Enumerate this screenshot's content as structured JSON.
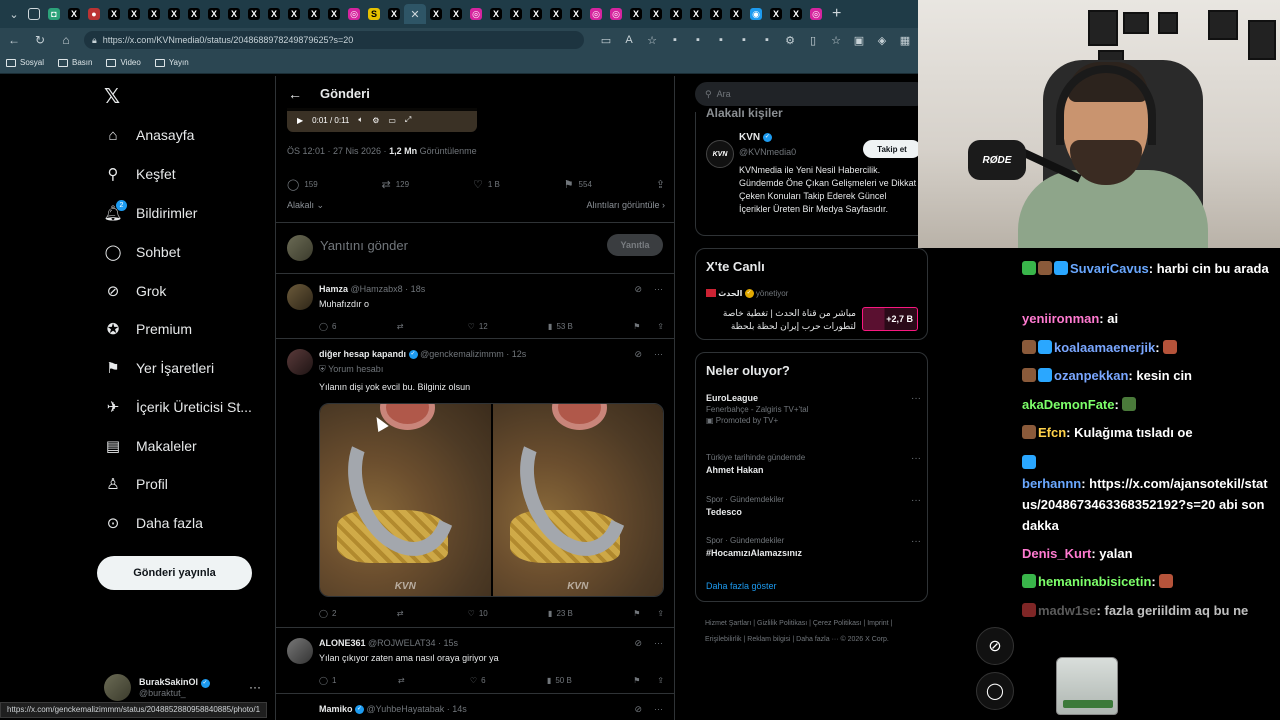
{
  "browser": {
    "url": "https://x.com/KVNmedia0/status/2048688978249879625?s=20",
    "bookmarks": [
      "Sosyal",
      "Basın",
      "Video",
      "Yayın"
    ],
    "status_link": "https://x.com/genckemalizimmm/status/2048852880958840885/photo/1"
  },
  "sidebar": {
    "logo": "𝕏",
    "items": [
      {
        "label": "Anasayfa",
        "icon": "home-icon"
      },
      {
        "label": "Keşfet",
        "icon": "search-icon"
      },
      {
        "label": "Bildirimler",
        "icon": "bell-icon",
        "badge": "2"
      },
      {
        "label": "Sohbet",
        "icon": "chat-icon"
      },
      {
        "label": "Grok",
        "icon": "grok-icon"
      },
      {
        "label": "Premium",
        "icon": "premium-icon"
      },
      {
        "label": "Yer İşaretleri",
        "icon": "bookmark-icon"
      },
      {
        "label": "İçerik Üreticisi St...",
        "icon": "rocket-icon"
      },
      {
        "label": "Makaleler",
        "icon": "article-icon"
      },
      {
        "label": "Profil",
        "icon": "person-icon"
      },
      {
        "label": "Daha fazla",
        "icon": "more-icon"
      }
    ],
    "post_button": "Gönderi yayınla",
    "profile": {
      "name": "BurakSakinOl",
      "handle": "@buraktut_",
      "more": "···"
    }
  },
  "main": {
    "header_title": "Gönderi",
    "video_time": "0:01 / 0:11",
    "meta_time": "ÖS 12:01 · 27 Nis 2026 · ",
    "meta_views": "1,2 Mn",
    "meta_views_label": " Görüntülenme",
    "stats": {
      "replies": "159",
      "reposts": "129",
      "likes": "1 B",
      "bookmarks": "554"
    },
    "sort_label": "Alakalı",
    "quotes_label": "Alıntıları görüntüle",
    "reply_placeholder": "Yanıtını gönder",
    "reply_button": "Yanıtla",
    "tweets": [
      {
        "name": "Hamza",
        "handle": "@Hamzabx8 · 18s",
        "text": "Muhafızdır o",
        "replies": "6",
        "reposts": "",
        "likes": "12",
        "views": "53 B"
      },
      {
        "name": "diğer hesap kapandı",
        "handle": "@genckemalizimmm · 12s",
        "note": "Yorum hesabı",
        "text": "Yılanın dişi yok evcil bu. Bilginiz olsun",
        "watermark": "KVN",
        "replies": "2",
        "reposts": "",
        "likes": "10",
        "views": "23 B"
      },
      {
        "name": "ALONE361",
        "handle": "@ROJWELAT34 · 15s",
        "text": "Yılan çıkıyor zaten ama nasıl oraya giriyor ya",
        "replies": "1",
        "reposts": "",
        "likes": "6",
        "views": "50 B"
      },
      {
        "name": "Mamiko",
        "handle": "@YuhbeHayatabak · 14s",
        "text": "",
        "replies": "",
        "reposts": "",
        "likes": "",
        "views": ""
      }
    ]
  },
  "right": {
    "search_placeholder": "Ara",
    "account_card_title": "Alakalı kişiler",
    "account": {
      "logo": "KVN",
      "name": "KVN",
      "handle": "@KVNmedia0",
      "follow": "Takip et",
      "bio": "KVNmedia ile Yeni Nesil Habercilik. Gündemde Öne Çıkan Gelişmeleri ve Dikkat Çeken Konuları Takip Ederek Güncel İçerikler Üreten Bir Medya Sayfasıdır."
    },
    "live_title": "X'te Canlı",
    "live": {
      "channel": "الحدث",
      "status": "yönetiyor",
      "text": "مباشر من قناة الحدث | تغطية خاصة لتطورات حرب إيران لحظة بلحظة",
      "count": "+2,7 B"
    },
    "trends_title": "Neler oluyor?",
    "trends": [
      {
        "cat": "",
        "title": "EuroLeague",
        "sub": "Fenerbahçe - Zalgiris TV+'tal",
        "promo": "Promoted by TV+"
      },
      {
        "cat": "Türkiye tarihinde gündemde",
        "title": "Ahmet Hakan",
        "sub": "",
        "promo": ""
      },
      {
        "cat": "Spor · Gündemdekiler",
        "title": "Tedesco",
        "sub": "",
        "promo": ""
      },
      {
        "cat": "Spor · Gündemdekiler",
        "title": "#HocamızıAlamazsınız",
        "sub": "",
        "promo": ""
      }
    ],
    "show_more": "Daha fazla göster",
    "footer": "Hizmet Şartları | Gizlilik Politikası | Çerez Politikası | Imprint | Erişilebilirlik | Reklam bilgisi | Daha fazla ··· © 2026 X Corp."
  },
  "webcam": {
    "mic_label": "RØDE"
  },
  "chat": [
    {
      "user": "SuvariCavus",
      "color": "#6aa8ff",
      "text": ": harbi cin bu arada"
    },
    {
      "user": "yeniironman",
      "color": "#ff7ad0",
      "text": ": ai"
    },
    {
      "user": "koalaamaenerjik",
      "color": "#7aa7ff",
      "text": ": "
    },
    {
      "user": "ozanpekkan",
      "color": "#7aa7ff",
      "text": ": kesin cin"
    },
    {
      "user": "akaDemonFate",
      "color": "#7dff6a",
      "text": ": "
    },
    {
      "user": "Efcn",
      "color": "#ffd24a",
      "text": ": Kulağıma tısladı oe"
    },
    {
      "user": "berhannn",
      "color": "#6aa8ff",
      "text": ": https://x.com/ajansotekil/status/2048673463368352192?s=20 abi son dakka"
    },
    {
      "user": "Denis_Kurt",
      "color": "#ff7ad0",
      "text": ": yalan"
    },
    {
      "user": "hemaninabisicetin",
      "color": "#7dff6a",
      "text": ": "
    },
    {
      "user": "madw1se",
      "color": "#7a7a7a",
      "text": ": fazla geriildim aq bu ne"
    }
  ]
}
